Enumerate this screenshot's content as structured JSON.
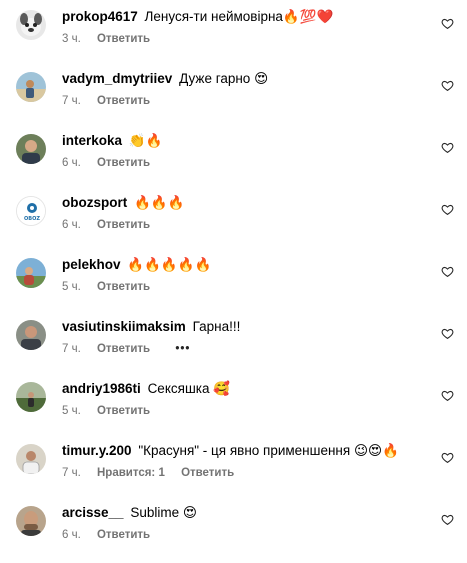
{
  "comments": [
    {
      "username": "prokop4617",
      "text": "Ленуся-ти неймовірна🔥💯❤️",
      "time": "3 ч.",
      "reply": "Ответить",
      "avatar": "dog-avatar"
    },
    {
      "username": "vadym_dmytriiev",
      "text": "Дуже гарно 😍",
      "time": "7 ч.",
      "reply": "Ответить",
      "avatar": "beach-avatar"
    },
    {
      "username": "interkoka",
      "text": "👏🔥",
      "time": "6 ч.",
      "reply": "Ответить",
      "avatar": "man-avatar"
    },
    {
      "username": "obozsport",
      "text": "🔥🔥🔥",
      "time": "6 ч.",
      "reply": "Ответить",
      "avatar": "logo-avatar",
      "avatar_text": "OBOZ"
    },
    {
      "username": "pelekhov",
      "text": "🔥🔥🔥🔥🔥",
      "time": "5 ч.",
      "reply": "Ответить",
      "avatar": "outdoor-avatar"
    },
    {
      "username": "vasiutinskiimaksim",
      "text": "Гарна!!!",
      "time": "7 ч.",
      "reply": "Ответить",
      "more": "•••",
      "avatar": "man-avatar-2"
    },
    {
      "username": "andriy1986ti",
      "text": "Сексяшка 🥰",
      "time": "5 ч.",
      "reply": "Ответить",
      "avatar": "field-avatar"
    },
    {
      "username": "timur.y.200",
      "text": "\"Красуня\" - ця явно применшення 😉😍🔥",
      "time": "7 ч.",
      "likes": "Нравится: 1",
      "reply": "Ответить",
      "avatar": "person-avatar"
    },
    {
      "username": "arcisse__",
      "text": "Sublime 😍",
      "time": "6 ч.",
      "reply": "Ответить",
      "avatar": "bald-man-avatar"
    }
  ],
  "colors": {
    "text": "#000000",
    "meta": "#737373",
    "background": "#ffffff"
  },
  "icons": {
    "like": "heart-outline-icon",
    "more": "more-options-icon"
  }
}
